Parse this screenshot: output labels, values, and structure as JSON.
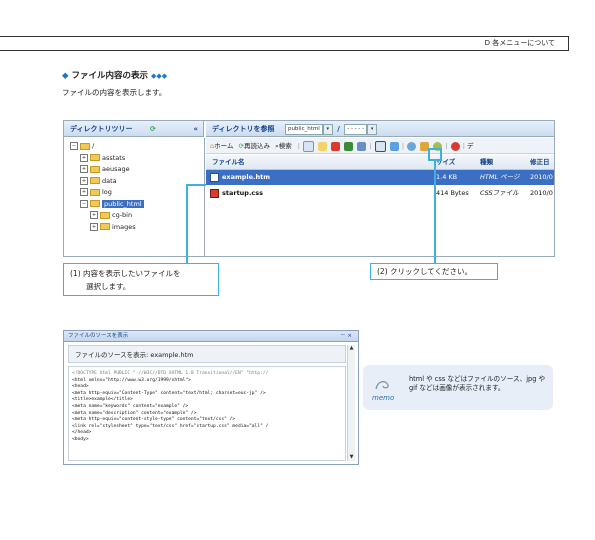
{
  "header": {
    "text": "D 各メニューについて"
  },
  "section": {
    "title": "ファイル内容の表示",
    "description": "ファイルの内容を表示します。"
  },
  "file_manager": {
    "tree_title": "ディレクトリツリー",
    "tree_collapse": "«",
    "main_title": "ディレクトリを参照",
    "dir_select": "public_html",
    "path_sep": "/",
    "path_select": "- - - - -",
    "toolbar": {
      "home": "ホーム",
      "reload": "再読込み",
      "search": "検索",
      "more": "デ"
    },
    "tree": [
      {
        "label": "/",
        "level": 0,
        "toggle": "−"
      },
      {
        "label": "asstats",
        "level": 1,
        "toggle": "+"
      },
      {
        "label": "aeusage",
        "level": 1,
        "toggle": "+"
      },
      {
        "label": "data",
        "level": 1,
        "toggle": "+"
      },
      {
        "label": "log",
        "level": 1,
        "toggle": "+"
      },
      {
        "label": "public_html",
        "level": 1,
        "toggle": "−",
        "selected": true
      },
      {
        "label": "cg-bin",
        "level": 2,
        "toggle": "+"
      },
      {
        "label": "images",
        "level": 2,
        "toggle": "+"
      }
    ],
    "columns": [
      "ファイル名",
      "サイズ",
      "種類",
      "修正日"
    ],
    "rows": [
      {
        "name": "example.htm",
        "size": "1.4 KB",
        "type": "HTML ページ",
        "date": "2010/0"
      },
      {
        "name": "startup.css",
        "size": "414 Bytes",
        "type": "CSSファイル",
        "date": "2010/0"
      }
    ]
  },
  "callouts": {
    "c1_line1": "(1) 内容を表示したいファイルを",
    "c1_line2": "選択します。",
    "c2": "(2) クリックしてください。"
  },
  "source_window": {
    "title": "ファイルのソースを表示",
    "controls": "－ ×",
    "subtitle": "ファイルのソースを表示: example.htm",
    "lines": [
      "<!DOCTYPE html PUBLIC \"-//W3C//DTD XHTML 1.0 Transitional//EN\" \"http://",
      "<html xmlns=\"http://www.w3.org/1999/xhtml\">",
      "<head>",
      "<meta http-equiv=\"Content-Type\" content=\"text/html; charset=euc-jp\" />",
      "<title>example</title>",
      "<meta name=\"keywords\" content=\"example\" />",
      "<meta name=\"description\" content=\"example\" />",
      "<meta http-equiv=\"content-style-type\" content=\"text/css\" />",
      "<link rel=\"stylesheet\" type=\"text/css\" href=\"startup.css\" media=\"all\" /",
      "</head>",
      "<body>"
    ]
  },
  "memo": {
    "label": "memo",
    "text": "html や css などはファイルのソース、jpg や gif などは画像が表示されます。"
  }
}
